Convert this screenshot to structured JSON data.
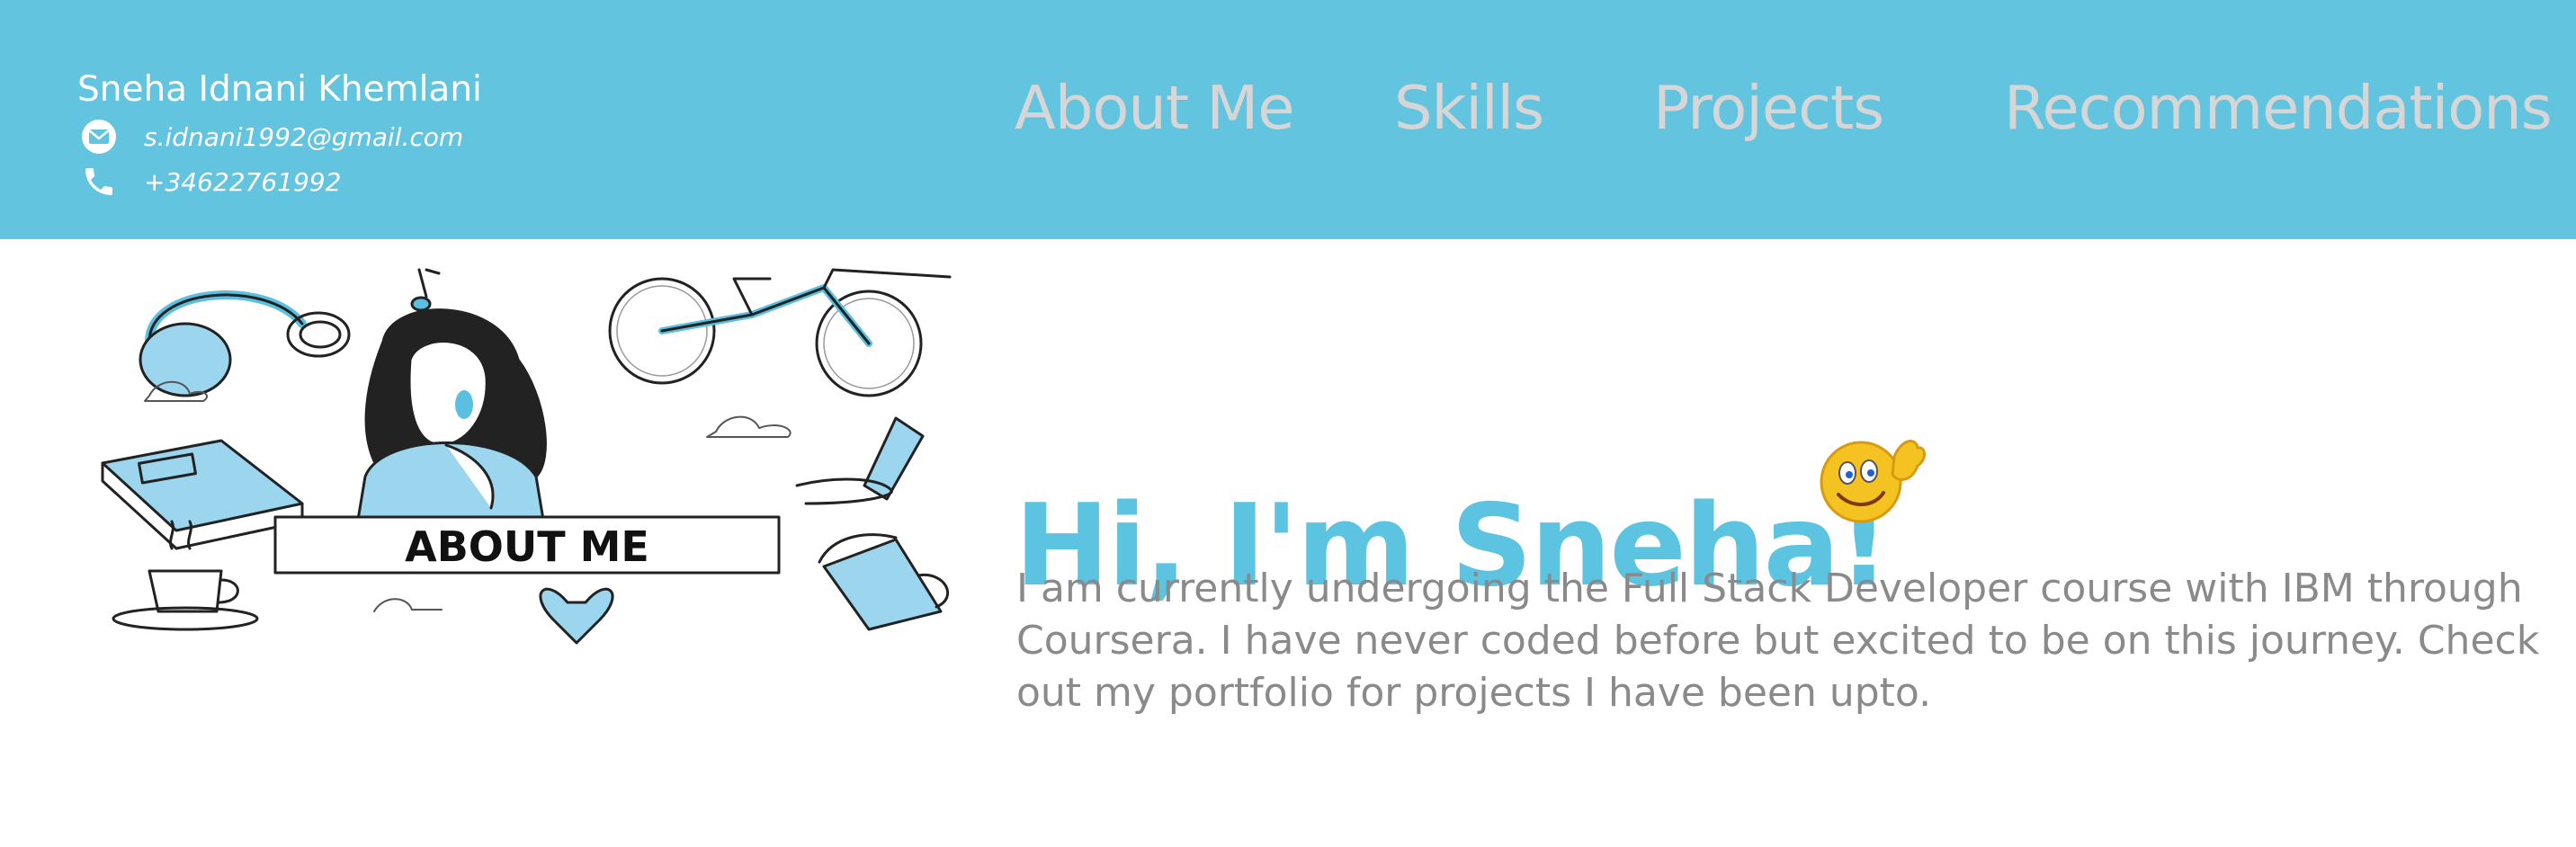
{
  "header": {
    "name": "Sneha Idnani Khemlani",
    "email": "s.idnani1992@gmail.com",
    "phone": "+34622761992",
    "email_icon": "envelope-icon",
    "phone_icon": "phone-icon",
    "background": "#63c4e0"
  },
  "nav": {
    "items": [
      {
        "label": "About Me"
      },
      {
        "label": "Skills"
      },
      {
        "label": "Projects"
      },
      {
        "label": "Recommendations"
      }
    ],
    "color": "#d6d6d6"
  },
  "hero": {
    "image_label": "ABOUT ME",
    "title": "Hi, I'm Sneha!",
    "emoji_icon": "waving-smiley-icon",
    "text": "I am currently undergoing the Full Stack Developer course with IBM through Coursera. I have never coded before but excited to be on this journey. Check out my portfolio for projects I have been upto.",
    "title_color": "#5cc3e0",
    "text_color": "#8a8a8a"
  }
}
